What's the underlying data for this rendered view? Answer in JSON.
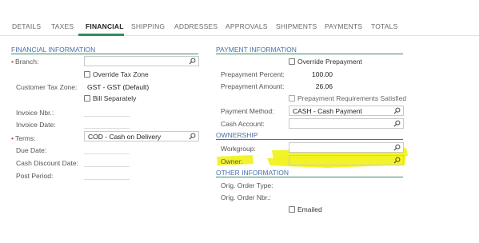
{
  "tabs": [
    {
      "label": "DETAILS"
    },
    {
      "label": "TAXES"
    },
    {
      "label": "FINANCIAL"
    },
    {
      "label": "SHIPPING"
    },
    {
      "label": "ADDRESSES"
    },
    {
      "label": "APPROVALS"
    },
    {
      "label": "SHIPMENTS"
    },
    {
      "label": "PAYMENTS"
    },
    {
      "label": "TOTALS"
    }
  ],
  "active_tab": "FINANCIAL",
  "financial_info": {
    "title": "FINANCIAL INFORMATION",
    "branch_label": "Branch:",
    "branch_value": "",
    "override_tax_zone_label": "Override Tax Zone",
    "customer_tax_zone_label": "Customer Tax Zone:",
    "customer_tax_zone_value": "GST - GST (Default)",
    "bill_separately_label": "Bill Separately",
    "invoice_nbr_label": "Invoice Nbr.:",
    "invoice_date_label": "Invoice Date:",
    "terms_label": "Terms:",
    "terms_value": "COD - Cash on Delivery",
    "due_date_label": "Due Date:",
    "cash_discount_date_label": "Cash Discount Date:",
    "post_period_label": "Post Period:"
  },
  "payment_info": {
    "title": "PAYMENT INFORMATION",
    "override_prepayment_label": "Override Prepayment",
    "prepayment_percent_label": "Prepayment Percent:",
    "prepayment_percent_value": "100.00",
    "prepayment_amount_label": "Prepayment Amount:",
    "prepayment_amount_value": "26.06",
    "prepayment_req_label": "Prepayment Requirements Satisfied",
    "payment_method_label": "Payment Method:",
    "payment_method_value": "CASH - Cash Payment",
    "cash_account_label": "Cash Account:",
    "cash_account_value": ""
  },
  "ownership": {
    "title": "OWNERSHIP",
    "workgroup_label": "Workgroup:",
    "workgroup_value": "",
    "owner_label": "Owner:",
    "owner_value": ""
  },
  "other_info": {
    "title": "OTHER INFORMATION",
    "orig_order_type_label": "Orig. Order Type:",
    "orig_order_nbr_label": "Orig. Order Nbr.:",
    "emailed_label": "Emailed"
  },
  "colors": {
    "accent": "#2f8d5c",
    "section_title": "#4a6fa5",
    "highlight": "#f2f21a"
  },
  "icons": [
    "search-icon"
  ]
}
